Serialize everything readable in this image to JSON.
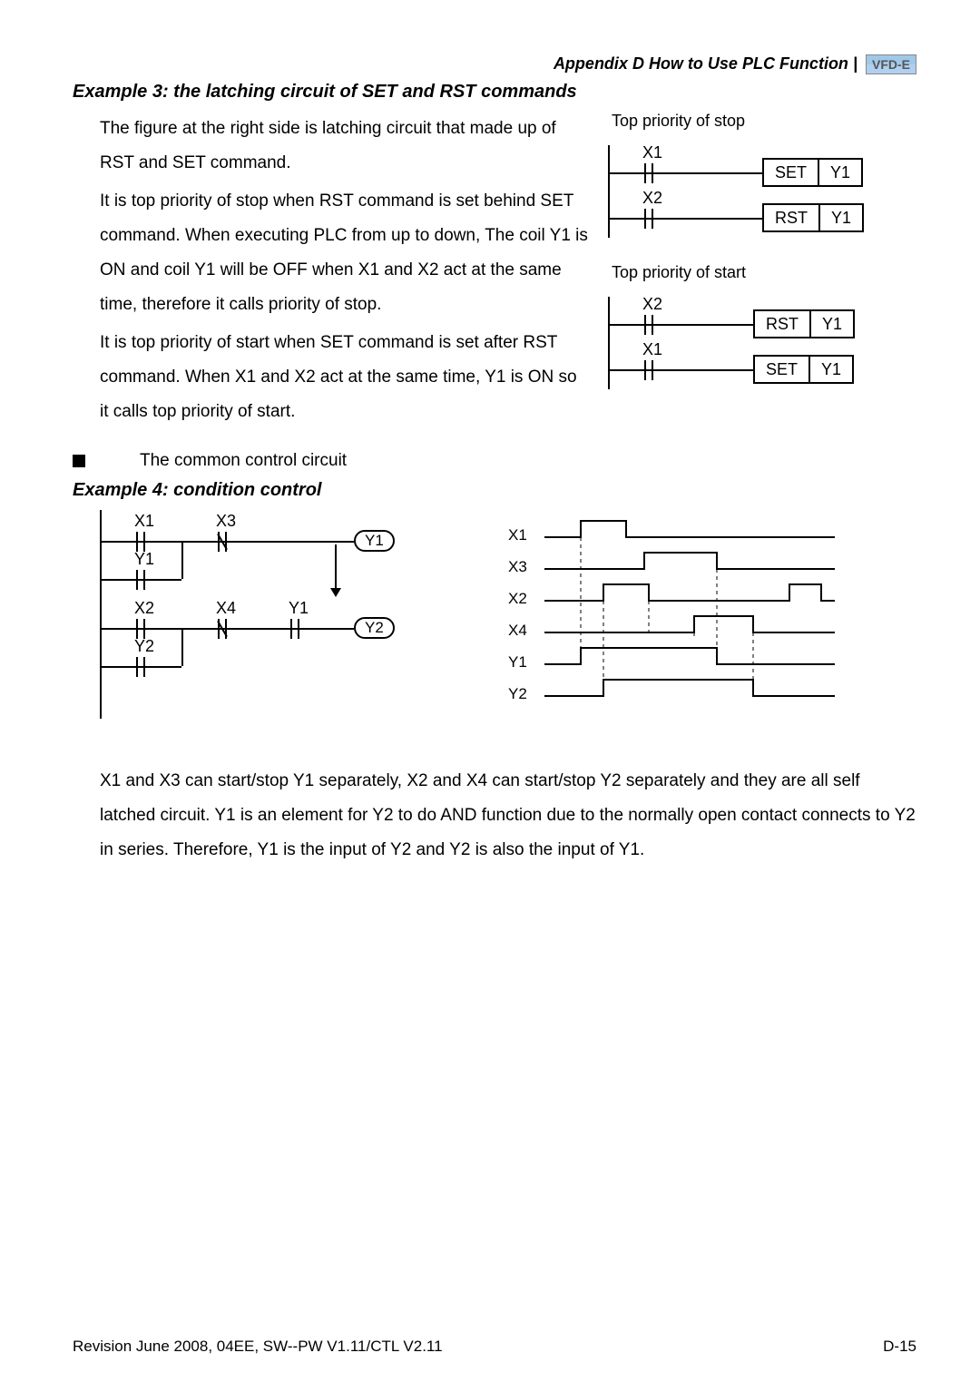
{
  "header": {
    "appendix": "Appendix D How to Use PLC Function",
    "logo": "VFD-E"
  },
  "example3": {
    "title": "Example 3: the latching circuit of SET and RST commands",
    "para1": "The figure at the right side is latching circuit that made up of RST and SET command.",
    "para2": "It is top priority of stop when RST command is set behind SET command. When executing PLC from up to down, The coil Y1 is ON and coil Y1 will be OFF when X1 and X2 act at the same time, therefore it calls priority of stop.",
    "para3": "It is top priority of start when SET command is set after RST command. When X1 and X2 act at the same time, Y1 is ON so it calls top priority of start.",
    "diag1": {
      "title": "Top priority of stop",
      "c1": "X1",
      "c2": "X2",
      "i1a": "SET",
      "i1b": "Y1",
      "i2a": "RST",
      "i2b": "Y1"
    },
    "diag2": {
      "title": "Top priority of start",
      "c1": "X2",
      "c2": "X1",
      "i1a": "RST",
      "i1b": "Y1",
      "i2a": "SET",
      "i2b": "Y1"
    }
  },
  "bullet": "The common control circuit",
  "example4": {
    "title": "Example 4: condition control",
    "ladder": {
      "r1c1": "X1",
      "r1c2": "X3",
      "r1o": "Y1",
      "r2c1": "Y1",
      "r3c1": "X2",
      "r3c2": "X4",
      "r3c3": "Y1",
      "r3o": "Y2",
      "r4c1": "Y2"
    },
    "timing": {
      "s1": "X1",
      "s2": "X3",
      "s3": "X2",
      "s4": "X4",
      "s5": "Y1",
      "s6": "Y2"
    },
    "para": "X1 and X3 can start/stop Y1 separately, X2 and X4 can start/stop Y2 separately and they are all self latched circuit. Y1 is an element for Y2 to do AND function due to the normally open contact connects to Y2 in series. Therefore, Y1 is the input of Y2 and Y2 is also the input of Y1."
  },
  "footer": {
    "left": "Revision June 2008, 04EE, SW--PW V1.11/CTL V2.11",
    "right": "D-15"
  }
}
